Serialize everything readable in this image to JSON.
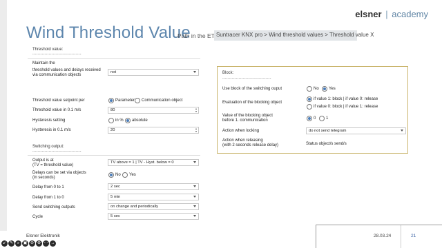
{
  "brand": {
    "name": "elsner",
    "sep": "|",
    "suffix": "academy"
  },
  "title": "Wind Threshold Value",
  "path": {
    "label": "Path in the ETS :",
    "value": "Suntracer KNX pro > Wind threshold values > Threshold value X"
  },
  "left": {
    "threshold_section": "Threshold value:",
    "dashes": "------------------------------------",
    "maintain_label": "Maintain the",
    "maintain_desc_1": "threshold values and delays received",
    "maintain_desc_2": "via communication objects",
    "maintain_value": "not",
    "setpoint_label": "Threshold value setpoint per",
    "setpoint_opt1": "Parameter",
    "setpoint_opt2": "Communication object",
    "threshold_label": "Threshold value in 0.1 m/s",
    "threshold_value": "80",
    "hyst_label": "Hysteresis setting",
    "hyst_opt1": "in %",
    "hyst_opt2": "absolute",
    "hyst_value_label": "Hysteresis in 0.1 m/s",
    "hyst_value": "20",
    "switching_section": "Switching output:",
    "output_label_1": "Output is at",
    "output_label_2": "(TV = threshold value)",
    "output_value": "TV above    = 1 | TV - Hyst. below  = 0",
    "delays_label_1": "Delays can be set via objects",
    "delays_label_2": "(in seconds)",
    "delays_opt1": "No",
    "delays_opt2": "Yes",
    "delay01_label": "Delay from 0 to 1",
    "delay01_value": "2 sec",
    "delay10_label": "Delay from 1 to 0",
    "delay10_value": "5 min",
    "send_label": "Send switching outputs",
    "send_value": "on change and periodically",
    "cycle_label": "Cycle",
    "cycle_value": "5 sec"
  },
  "block": {
    "heading": "Block:",
    "dashes": "------------------------------------",
    "use_label": "Use block of the switching ouput",
    "use_opt1": "No",
    "use_opt2": "Yes",
    "eval_label": "Evaluation of the blocking object",
    "eval_opt1": "if value  1: block  |  if value 0: release",
    "eval_opt2": "if value  0: block  |  if value 1: release",
    "value_label_1": "Value of the blocking object",
    "value_label_2": "before 1. communication",
    "value_opt1": "0",
    "value_opt2": "1",
    "locking_label": "Action when locking",
    "locking_value": "do not send telegram",
    "release_label_1": "Action when releasing",
    "release_label_2": "(with 2 seconds release delay)",
    "release_value": "Status object/s send/s"
  },
  "footer": {
    "company": "Elsner Elektronik",
    "date": "28.03.24",
    "page": "21"
  },
  "tools": [
    "↙",
    "✎",
    "⌕",
    "▣",
    "⊖",
    "⊕",
    "⋯",
    "→"
  ],
  "colors": {
    "title": "#5d86ad",
    "panel_border": "#c9b46a",
    "radio_on": "#4a7cb8"
  }
}
